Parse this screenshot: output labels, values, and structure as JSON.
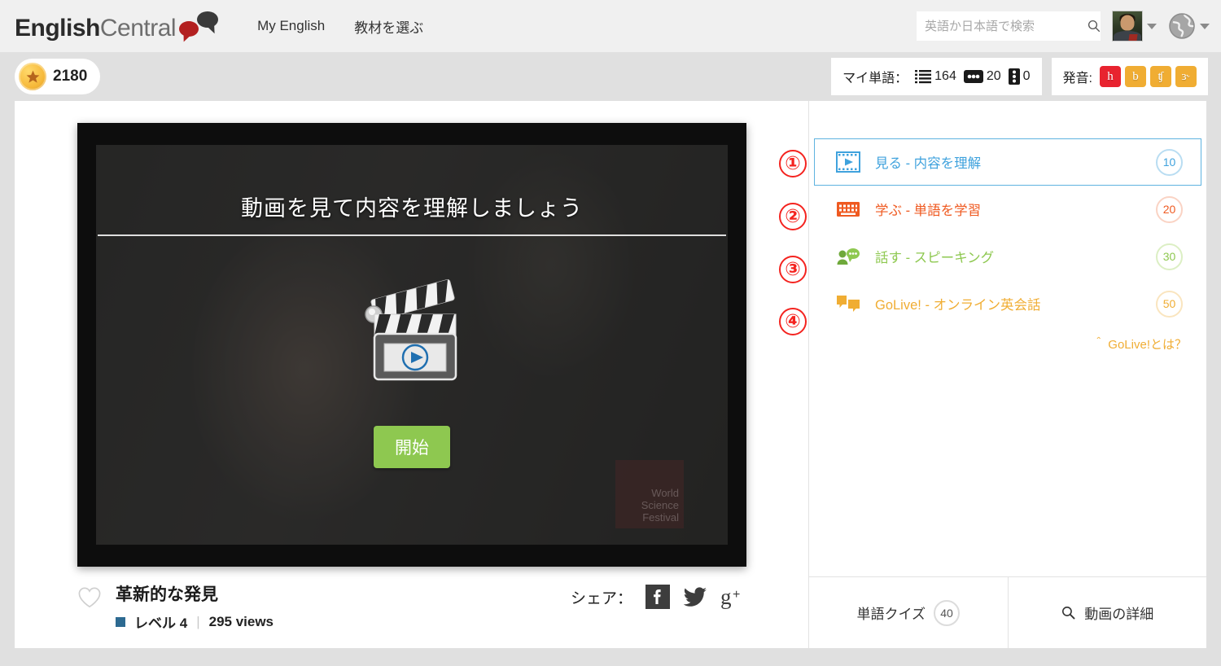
{
  "brand": {
    "logo_primary": "English",
    "logo_secondary": "Central"
  },
  "nav": {
    "items": [
      {
        "label": "My English",
        "name": "nav-my-english"
      },
      {
        "label": "教材を選ぶ",
        "name": "nav-choose-material"
      }
    ]
  },
  "search": {
    "placeholder": "英語か日本語で検索",
    "value": "",
    "icon": "search-icon"
  },
  "account": {
    "avatar": "user-avatar",
    "caret": "chevron-down-icon",
    "globe": "globe-icon"
  },
  "subheader": {
    "points": "2180",
    "points_icon": "star-coin-icon",
    "vocab_label": "マイ単語：",
    "vocab_stats": [
      {
        "icon": "word-list-icon",
        "value": "164"
      },
      {
        "icon": "flashcard-icon",
        "value": "20"
      },
      {
        "icon": "film-strip-icon",
        "value": "0"
      }
    ],
    "pron_label": "発音:",
    "pron_badges": [
      {
        "glyph": "h",
        "color": "#e8232f"
      },
      {
        "glyph": "b",
        "color": "#f0ad33"
      },
      {
        "glyph": "ʧ",
        "color": "#f0ad33"
      },
      {
        "glyph": "ɜ˞",
        "color": "#f0ad33"
      }
    ]
  },
  "video": {
    "overlay_title": "動画を見て内容を理解しましょう",
    "start_label": "開始",
    "play_icon": "clapperboard-play-icon",
    "watermark_lines": [
      "World",
      "Science",
      "Festival"
    ]
  },
  "meta": {
    "favorite_icon": "heart-icon",
    "title": "革新的な発見",
    "level": "レベル 4",
    "level_color": "#2d6a91",
    "divider": "|",
    "views": "295 views",
    "share_label": "シェア：",
    "share_icons": [
      {
        "name": "facebook-icon",
        "label": "f"
      },
      {
        "name": "twitter-icon",
        "label": "t"
      },
      {
        "name": "google-plus-icon",
        "label": "g+"
      }
    ]
  },
  "activities": [
    {
      "anno": "①",
      "icon": "watch-film-icon",
      "label": "見る - 内容を理解",
      "score": "10",
      "color": "#3fa2dd",
      "active": true
    },
    {
      "anno": "②",
      "icon": "learn-keyboard-icon",
      "label": "学ぶ - 単語を学習",
      "score": "20",
      "color": "#ef5a21",
      "active": false
    },
    {
      "anno": "③",
      "icon": "speak-person-icon",
      "label": "話す - スピーキング",
      "score": "30",
      "color": "#8ec850",
      "active": false
    },
    {
      "anno": "④",
      "icon": "golive-chat-icon",
      "label": "GoLive! - オンライン英会話",
      "score": "50",
      "color": "#f0ad33",
      "active": false
    }
  ],
  "golive_link": "＾ GoLive!とは？",
  "right_bottom": {
    "quiz_label": "単語クイズ",
    "quiz_score": "40",
    "details_icon": "magnifier-icon",
    "details_label": "動画の詳細"
  }
}
